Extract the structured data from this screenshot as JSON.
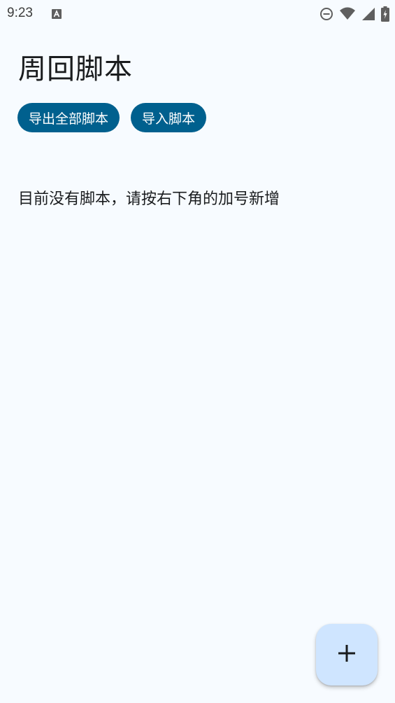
{
  "status_bar": {
    "time": "9:23",
    "icons": [
      "notification-a-icon",
      "do-not-disturb-icon",
      "wifi-icon",
      "signal-icon",
      "battery-charging-icon"
    ]
  },
  "header": {
    "title": "周回脚本"
  },
  "actions": {
    "export_all_label": "导出全部脚本",
    "import_label": "导入脚本"
  },
  "main": {
    "empty_message": "目前没有脚本，请按右下角的加号新增"
  },
  "fab": {
    "icon": "plus-icon"
  },
  "colors": {
    "background": "#f7fbff",
    "button_primary": "#00608e",
    "fab_background": "#cfe5ff",
    "text": "#1a1c1e"
  }
}
